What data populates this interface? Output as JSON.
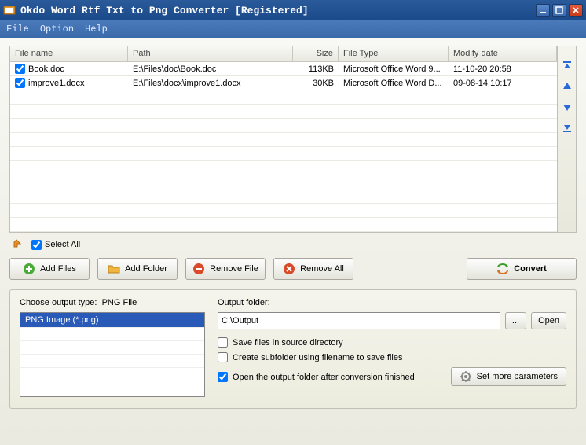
{
  "window": {
    "title": "Okdo Word Rtf Txt to Png Converter [Registered]"
  },
  "menu": {
    "file": "File",
    "option": "Option",
    "help": "Help"
  },
  "columns": {
    "name": "File name",
    "path": "Path",
    "size": "Size",
    "type": "File Type",
    "date": "Modify date"
  },
  "files": [
    {
      "checked": true,
      "name": "Book.doc",
      "path": "E:\\Files\\doc\\Book.doc",
      "size": "113KB",
      "type": "Microsoft Office Word 9...",
      "date": "11-10-20 20:58"
    },
    {
      "checked": true,
      "name": "improve1.docx",
      "path": "E:\\Files\\docx\\improve1.docx",
      "size": "30KB",
      "type": "Microsoft Office Word D...",
      "date": "09-08-14 10:17"
    }
  ],
  "select_all": {
    "label": "Select All",
    "checked": true
  },
  "toolbar": {
    "add_files": "Add Files",
    "add_folder": "Add Folder",
    "remove_file": "Remove File",
    "remove_all": "Remove All",
    "convert": "Convert"
  },
  "output_type": {
    "label_prefix": "Choose output type:",
    "current": "PNG File",
    "options": [
      "PNG Image (*.png)"
    ]
  },
  "output": {
    "label": "Output folder:",
    "path": "C:\\Output",
    "browse": "...",
    "open": "Open",
    "save_source": {
      "label": "Save files in source directory",
      "checked": false
    },
    "create_sub": {
      "label": "Create subfolder using filename to save files",
      "checked": false
    },
    "open_after": {
      "label": "Open the output folder after conversion finished",
      "checked": true
    },
    "more": "Set more parameters"
  }
}
